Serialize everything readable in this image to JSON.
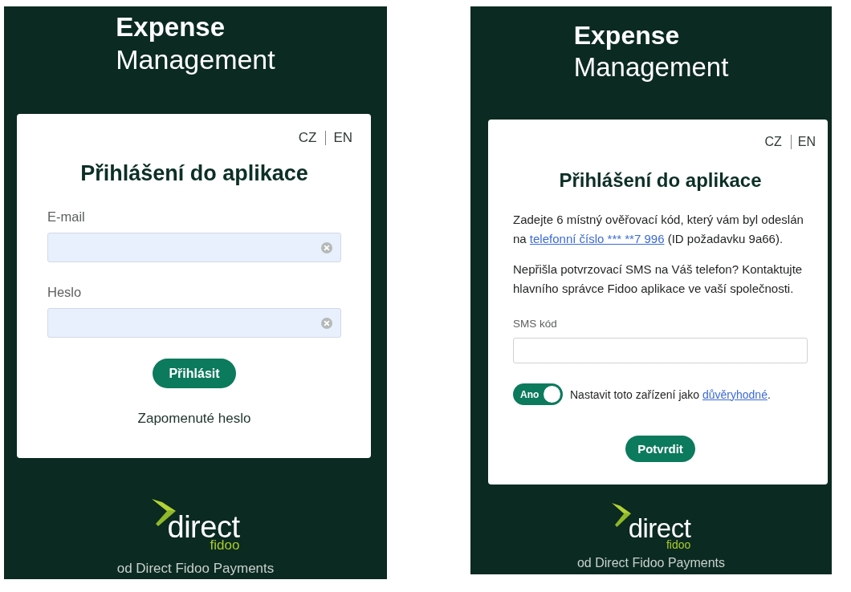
{
  "screens": [
    {
      "header": {
        "title_bold": "Expense",
        "title": "Management"
      },
      "card": {
        "languages": [
          {
            "label": "CZ"
          },
          {
            "label": "EN"
          }
        ],
        "heading": "Přihlášení do aplikace",
        "blocks": [
          {
            "kind": "field",
            "label": "E-mail",
            "autofilled": true,
            "clearable": true
          },
          {
            "kind": "field",
            "label": "Heslo",
            "autofilled": true,
            "clearable": true
          },
          {
            "kind": "button",
            "label": "Přihlásit"
          },
          {
            "kind": "link",
            "label": "Zapomenuté heslo"
          }
        ]
      },
      "footer": {
        "wordmark": "direct",
        "wordmark_sub": "fidoo",
        "tagline": "od Direct Fidoo Payments"
      }
    },
    {
      "header": {
        "title_bold": "Expense",
        "title": "Management"
      },
      "card": {
        "languages": [
          {
            "label": "CZ"
          },
          {
            "label": "EN"
          }
        ],
        "heading": "Přihlášení do aplikace",
        "blocks": [
          {
            "kind": "paragraph",
            "parts": [
              {
                "kind": "text",
                "text": "Zadejte 6 místný ověřovací kód, který vám byl odeslán na "
              },
              {
                "kind": "link",
                "text": "telefonní číslo *** **7 996"
              },
              {
                "kind": "text",
                "text": " (ID požadavku 9a66)."
              }
            ]
          },
          {
            "kind": "paragraph",
            "parts": [
              {
                "kind": "text",
                "text": "Nepřišla potvrzovací SMS na Váš telefon? Kontaktujte hlavního správce Fidoo aplikace ve vaší společnosti."
              }
            ]
          },
          {
            "kind": "field",
            "label": "SMS kód",
            "autofilled": false,
            "clearable": false
          },
          {
            "kind": "toggle",
            "label": "Ano",
            "on": true,
            "parts": [
              {
                "kind": "text",
                "text": "Nastavit toto zařízení jako "
              },
              {
                "kind": "link",
                "text": "důvěryhodné"
              },
              {
                "kind": "text",
                "text": "."
              }
            ]
          },
          {
            "kind": "button",
            "label": "Potvrdit"
          }
        ]
      },
      "footer": {
        "wordmark": "direct",
        "wordmark_sub": "fidoo",
        "tagline": "od Direct Fidoo Payments"
      }
    }
  ]
}
